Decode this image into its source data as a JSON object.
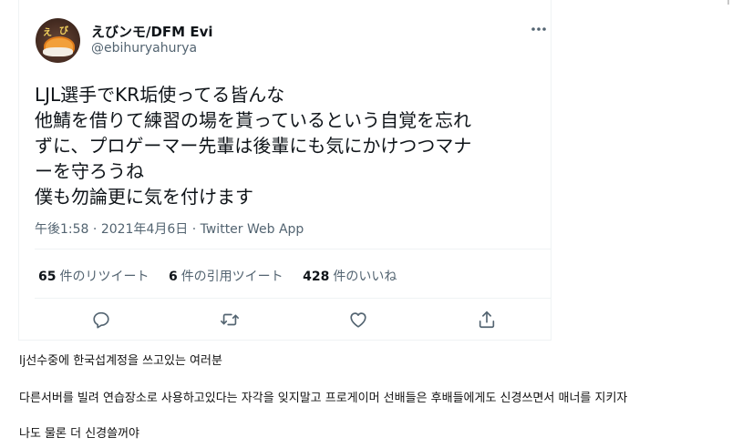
{
  "tweet": {
    "display_name": "えびンモ/DFM Evi",
    "handle": "@ebihuryahurya",
    "avatar_glyphs": [
      "え",
      "び"
    ],
    "more_icon": "more-icon",
    "text_lines": [
      "LJL選手でKR垢使ってる皆んな",
      "他鯖を借りて練習の場を貰っているという自覚を忘れ",
      "ずに、プロゲーマー先輩は後輩にも気にかけつつマナ",
      "ーを守ろうね",
      "僕も勿論更に気を付けます"
    ],
    "time": "午後1:58",
    "separator": "·",
    "date": "2021年4月6日",
    "source": "Twitter Web App",
    "stats": {
      "retweets": {
        "count": "65",
        "label": "件のリツイート"
      },
      "quotes": {
        "count": "6",
        "label": "件の引用ツイート"
      },
      "likes": {
        "count": "428",
        "label": "件のいいね"
      }
    },
    "actions": [
      "reply-icon",
      "retweet-icon",
      "like-icon",
      "share-icon"
    ],
    "colors": {
      "text": "#0f1419",
      "secondary": "#536471",
      "border": "#eff3f4"
    }
  },
  "translation": {
    "lines": [
      "lj선수중에 한국섭계정을 쓰고있는 여러분",
      "다른서버를 빌려 연습장소로 사용하고있다는 자각을 잊지말고 프로게이머 선배들은 후배들에게도 신경쓰면서 매너를 지키자",
      "나도 물론 더 신경쓸꺼야"
    ]
  }
}
